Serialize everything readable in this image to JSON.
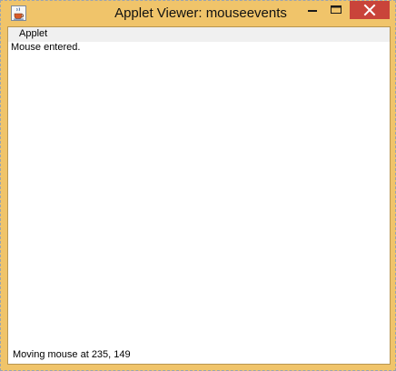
{
  "window": {
    "title": "Applet Viewer: mouseevents",
    "frame_color": "#f0c46a",
    "close_color": "#c9443a"
  },
  "icons": {
    "app": "java-cup-icon",
    "minimize": "minimize-icon",
    "maximize": "maximize-icon",
    "close": "close-icon"
  },
  "menubar": {
    "applet_label": "Applet"
  },
  "applet": {
    "message_top": "Mouse entered.",
    "message_bottom": "Moving mouse at 235, 149"
  }
}
